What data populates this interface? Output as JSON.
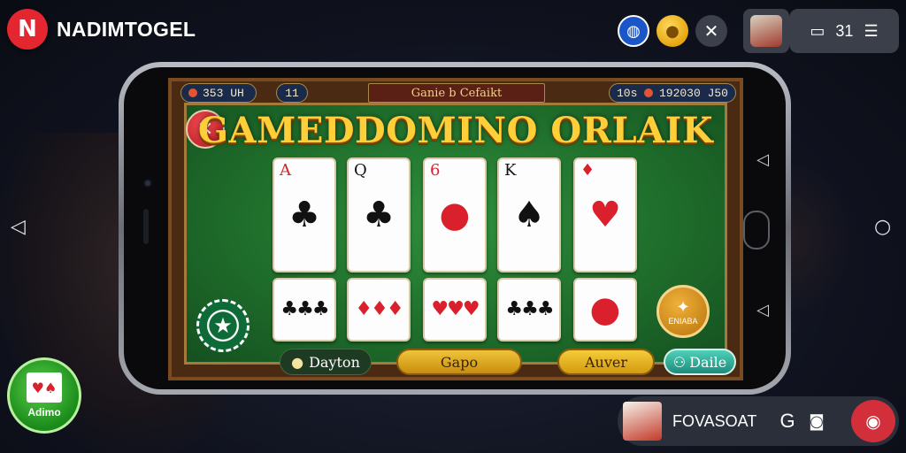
{
  "brand": {
    "logo_letter": "N",
    "name": "NADIMTOGEL"
  },
  "toolbar": {
    "world_icon": "globe-icon",
    "coin_icon": "coin-icon",
    "close_icon": "close-icon",
    "pill_text": "31"
  },
  "game": {
    "balance": "353 UH",
    "level": "11",
    "top_title": "Ganie b Cefaikt",
    "timer": "10s",
    "score": "192030 J50",
    "title": "GAMEDDOMINO ORLAIK",
    "cards_top": [
      {
        "rank": "A",
        "suit": "♣",
        "color": "blk",
        "center": "♣"
      },
      {
        "rank": "Q",
        "suit": "♠",
        "color": "blk",
        "center": "♣"
      },
      {
        "rank": "6",
        "suit": "♥",
        "color": "red",
        "center": "●"
      },
      {
        "rank": "K",
        "suit": "♠",
        "color": "blk",
        "center": "♠"
      },
      {
        "rank": "",
        "suit": "♦",
        "color": "red",
        "center": "♥"
      }
    ],
    "cards_bottom": [
      {
        "pips": "♣♣♣",
        "color": "blk"
      },
      {
        "pips": "♦♦♦",
        "color": "red"
      },
      {
        "pips": "♥♥♥",
        "color": "red"
      },
      {
        "pips": "♣♣♣",
        "color": "blk"
      },
      {
        "pips": "●",
        "color": "red"
      }
    ],
    "gold_chip_label": "ENIABA",
    "buttons": {
      "dayton": "Dayton",
      "gapo": "Gapo",
      "auver": "Auver",
      "daile": "Daile"
    }
  },
  "app_badge": {
    "label": "Adimo"
  },
  "bottom_pill": {
    "name": "FOVASOAT",
    "letter": "G"
  }
}
